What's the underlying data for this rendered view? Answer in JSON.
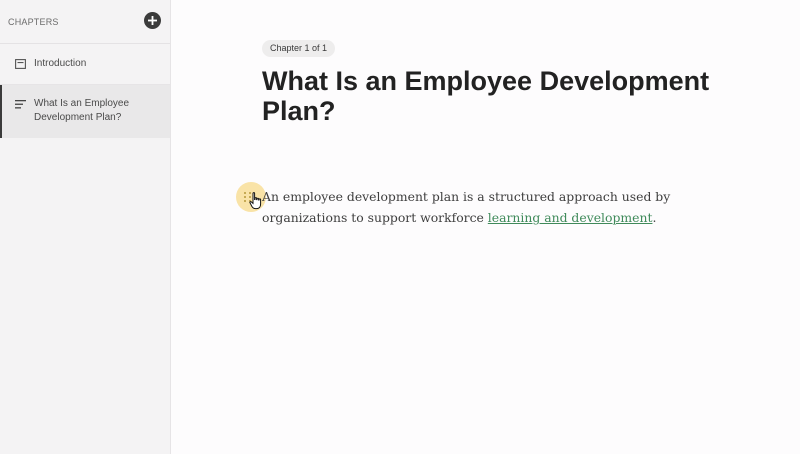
{
  "sidebar": {
    "title": "CHAPTERS",
    "add_icon": "plus-icon",
    "items": [
      {
        "label": "Introduction",
        "icon": "page-icon",
        "active": false
      },
      {
        "label": "What Is an Employee Development Plan?",
        "icon": "lines-icon",
        "active": true
      }
    ]
  },
  "main": {
    "chapter_badge": "Chapter 1 of 1",
    "title": "What Is an Employee Development Plan?",
    "paragraph": {
      "text_before": "An employee development plan is a structured approach used by organizations to support workforce ",
      "link_text": "learning and development",
      "text_after": "."
    },
    "drag_handle_icon": "drag-handle-icon",
    "cursor_icon": "hand-pointer-icon"
  },
  "colors": {
    "link": "#3f8a5a",
    "highlight": "#f6ce60",
    "sidebar_bg": "#f4f3f4"
  }
}
